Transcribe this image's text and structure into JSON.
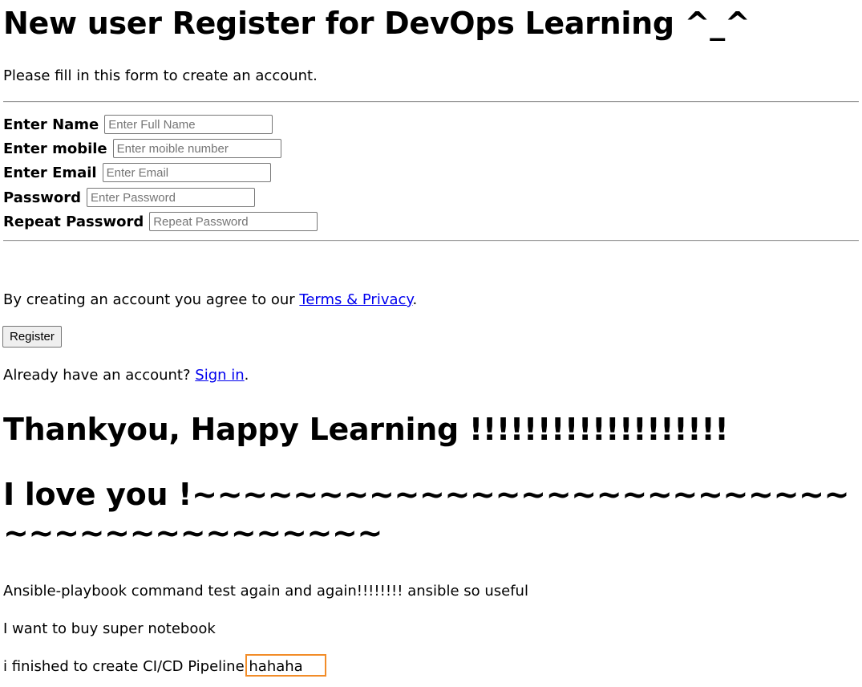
{
  "page": {
    "title": "New user Register for DevOps Learning ^_^",
    "intro": "Please fill in this form to create an account."
  },
  "form": {
    "fields": [
      {
        "label": "Enter Name",
        "placeholder": "Enter Full Name",
        "value": ""
      },
      {
        "label": "Enter mobile",
        "placeholder": "Enter moible number",
        "value": ""
      },
      {
        "label": "Enter Email",
        "placeholder": "Enter Email",
        "value": ""
      },
      {
        "label": "Password",
        "placeholder": "Enter Password",
        "value": ""
      },
      {
        "label": "Repeat Password",
        "placeholder": "Repeat Password",
        "value": ""
      }
    ],
    "terms_prefix": "By creating an account you agree to our ",
    "terms_link": "Terms & Privacy",
    "terms_suffix": ".",
    "register_label": "Register",
    "signin_prefix": "Already have an account? ",
    "signin_link": "Sign in",
    "signin_suffix": "."
  },
  "messages": {
    "thanks": "Thankyou, Happy Learning !!!!!!!!!!!!!!!!!!!",
    "love": "I love you !~~~~~~~~~~~~~~~~~~~~~~~~~~~~~~~~~~~~~~~~~",
    "line1": "Ansible-playbook command test again and again!!!!!!!! ansible so useful",
    "line2": "I want to buy super notebook",
    "line3": "i finished to create CI/CD Pipeline hahaha"
  },
  "colors": {
    "link": "#0000ee",
    "highlight": "#f28c28"
  }
}
